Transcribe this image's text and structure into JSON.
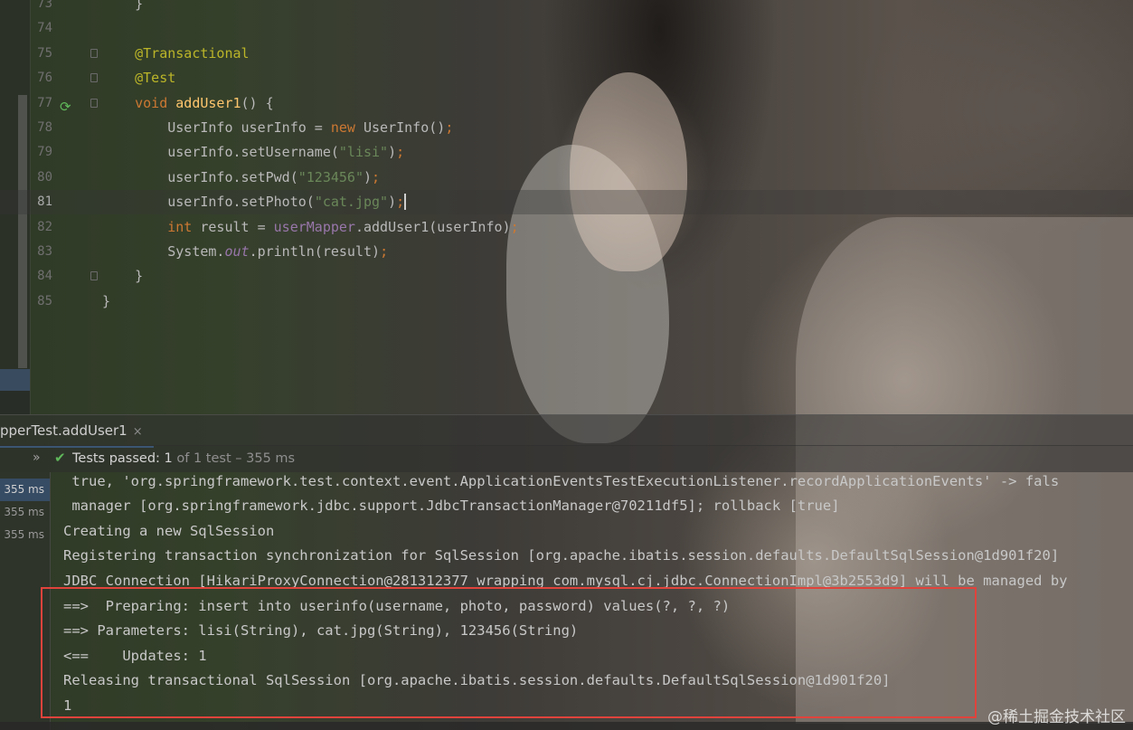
{
  "editor": {
    "lines": [
      {
        "num": "73",
        "tokens": [
          {
            "t": "    }",
            "c": ""
          }
        ]
      },
      {
        "num": "74",
        "tokens": []
      },
      {
        "num": "75",
        "tokens": [
          {
            "t": "    @Transactional",
            "c": "ann"
          }
        ]
      },
      {
        "num": "76",
        "tokens": [
          {
            "t": "    @Test",
            "c": "ann"
          }
        ]
      },
      {
        "num": "77",
        "tokens": [
          {
            "t": "    ",
            "c": ""
          },
          {
            "t": "void ",
            "c": "kw"
          },
          {
            "t": "addUser1",
            "c": "fn"
          },
          {
            "t": "() {",
            "c": ""
          }
        ]
      },
      {
        "num": "78",
        "tokens": [
          {
            "t": "        UserInfo userInfo = ",
            "c": ""
          },
          {
            "t": "new ",
            "c": "kw"
          },
          {
            "t": "UserInfo()",
            "c": ""
          },
          {
            "t": ";",
            "c": "kw"
          }
        ]
      },
      {
        "num": "79",
        "tokens": [
          {
            "t": "        userInfo.setUsername(",
            "c": ""
          },
          {
            "t": "\"lisi\"",
            "c": "str"
          },
          {
            "t": ")",
            "c": ""
          },
          {
            "t": ";",
            "c": "kw"
          }
        ]
      },
      {
        "num": "80",
        "tokens": [
          {
            "t": "        userInfo.setPwd(",
            "c": ""
          },
          {
            "t": "\"123456\"",
            "c": "str"
          },
          {
            "t": ")",
            "c": ""
          },
          {
            "t": ";",
            "c": "kw"
          }
        ]
      },
      {
        "num": "81",
        "tokens": [
          {
            "t": "        userInfo.setPhoto(",
            "c": ""
          },
          {
            "t": "\"cat.jpg\"",
            "c": "str"
          },
          {
            "t": ")",
            "c": ""
          },
          {
            "t": ";",
            "c": "kw caret"
          }
        ]
      },
      {
        "num": "82",
        "tokens": [
          {
            "t": "        ",
            "c": ""
          },
          {
            "t": "int ",
            "c": "kw"
          },
          {
            "t": "result = ",
            "c": ""
          },
          {
            "t": "userMapper",
            "c": "fld"
          },
          {
            "t": ".addUser1(userInfo)",
            "c": ""
          },
          {
            "t": ";",
            "c": "kw"
          }
        ]
      },
      {
        "num": "83",
        "tokens": [
          {
            "t": "        System.",
            "c": ""
          },
          {
            "t": "out",
            "c": "it"
          },
          {
            "t": ".println(result)",
            "c": ""
          },
          {
            "t": ";",
            "c": "kw"
          }
        ]
      },
      {
        "num": "84",
        "tokens": [
          {
            "t": "    }",
            "c": ""
          }
        ]
      },
      {
        "num": "85",
        "tokens": [
          {
            "t": "}",
            "c": ""
          }
        ]
      }
    ],
    "current_line": "81"
  },
  "run_tab": {
    "label": "pperTest.addUser1",
    "close": "×"
  },
  "status": {
    "chevron": "»",
    "passed": "Tests passed: ",
    "count": "1",
    "rest": " of 1 test – 355 ms"
  },
  "tree": {
    "items": [
      "355 ms",
      "355 ms",
      "355 ms"
    ]
  },
  "console": {
    "lines": [
      " true, 'org.springframework.test.context.event.ApplicationEventsTestExecutionListener.recordApplicationEvents' -> fals",
      " manager [org.springframework.jdbc.support.JdbcTransactionManager@70211df5]; rollback [true]",
      "Creating a new SqlSession",
      "Registering transaction synchronization for SqlSession [org.apache.ibatis.session.defaults.DefaultSqlSession@1d901f20]",
      "JDBC Connection [HikariProxyConnection@281312377 wrapping com.mysql.cj.jdbc.ConnectionImpl@3b2553d9] will be managed by",
      "==>  Preparing: insert into userinfo(username, photo, password) values(?, ?, ?)",
      "==> Parameters: lisi(String), cat.jpg(String), 123456(String)",
      "<==    Updates: 1",
      "Releasing transactional SqlSession [org.apache.ibatis.session.defaults.DefaultSqlSession@1d901f20]",
      "1"
    ]
  },
  "watermark": "@稀土掘金技术社区",
  "colors": {
    "highlight_box": "#e0433b",
    "accent": "#4a88c7",
    "pass": "#5fb85a"
  }
}
